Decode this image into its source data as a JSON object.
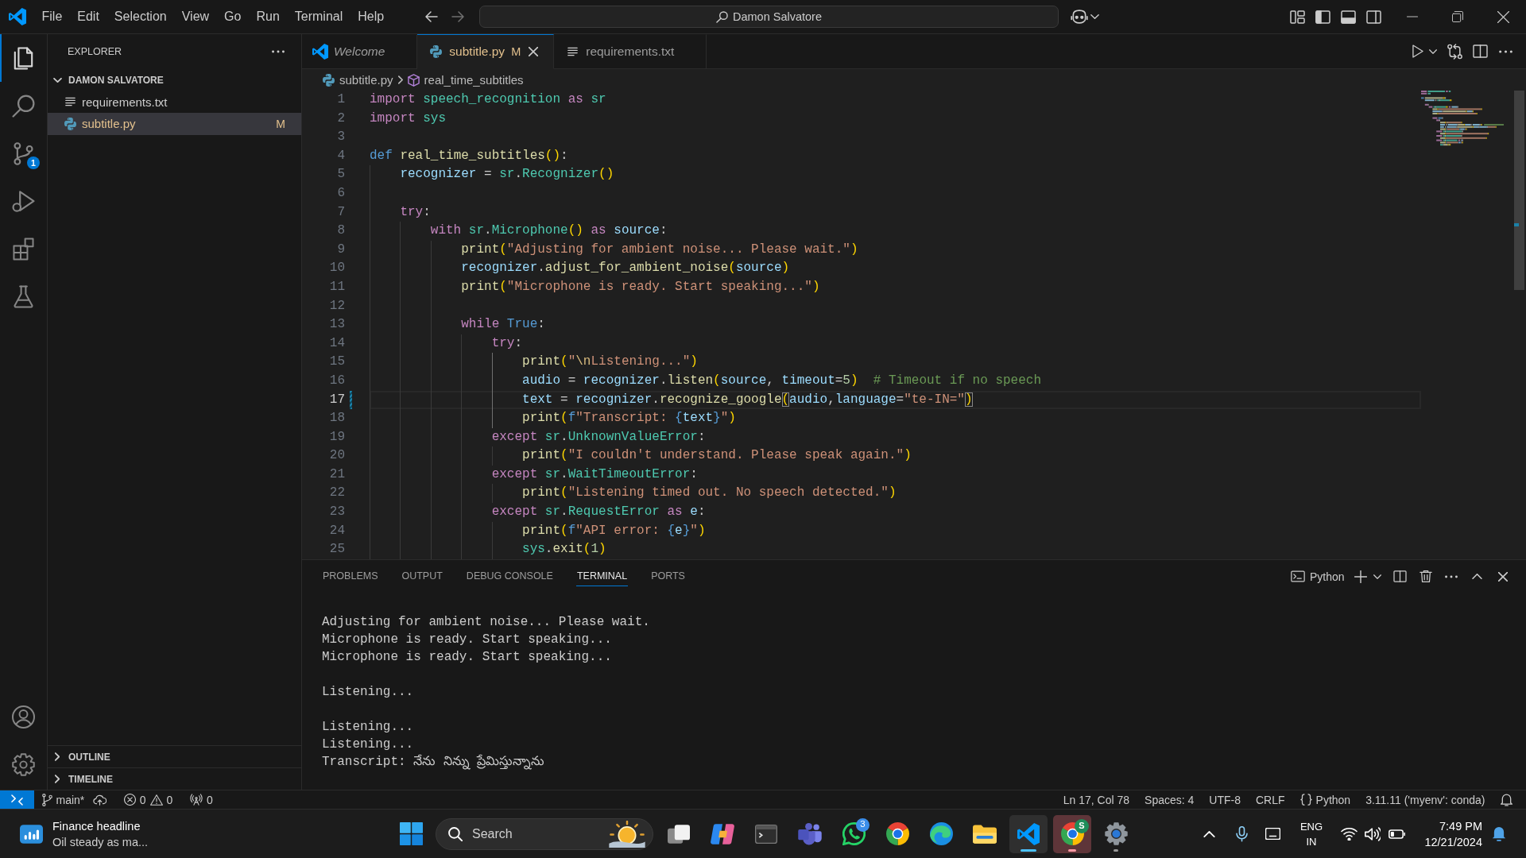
{
  "title_bar": {
    "menu": [
      "File",
      "Edit",
      "Selection",
      "View",
      "Go",
      "Run",
      "Terminal",
      "Help"
    ],
    "command_center": "Damon Salvatore",
    "layout_toggles": [
      {
        "kind": "primary_sidebar",
        "on": true
      },
      {
        "kind": "panel",
        "on": true
      },
      {
        "kind": "secondary_sidebar",
        "on": false
      }
    ]
  },
  "activity_bar": {
    "items": [
      {
        "kind": "explorer",
        "selected": true
      },
      {
        "kind": "search",
        "selected": false
      },
      {
        "kind": "source_control",
        "selected": false,
        "badge": "1"
      },
      {
        "kind": "run_debug",
        "selected": false
      },
      {
        "kind": "extensions",
        "selected": false
      },
      {
        "kind": "testing",
        "selected": false
      }
    ],
    "bottom_items": [
      {
        "kind": "accounts"
      },
      {
        "kind": "manage"
      }
    ]
  },
  "sidebar": {
    "title": "EXPLORER",
    "folder": {
      "name": "DAMON SALVATORE",
      "expanded": true,
      "files": [
        {
          "name": "requirements.txt",
          "kind": "text",
          "selected": false,
          "modified": false
        },
        {
          "name": "subtitle.py",
          "kind": "python",
          "selected": true,
          "modified": true,
          "badge": "M"
        }
      ]
    },
    "sections": [
      {
        "name": "OUTLINE",
        "expanded": false
      },
      {
        "name": "TIMELINE",
        "expanded": false
      }
    ]
  },
  "tabs": [
    {
      "label": "Welcome",
      "kind": "welcome",
      "selected": false,
      "preview": true,
      "modified": false
    },
    {
      "label": "subtitle.py",
      "kind": "python",
      "selected": true,
      "preview": false,
      "modified": true,
      "badge": "M"
    },
    {
      "label": "requirements.txt",
      "kind": "text",
      "selected": false,
      "preview": false,
      "modified": false
    }
  ],
  "breadcrumb": {
    "file": "subtitle.py",
    "symbol": "real_time_subtitles"
  },
  "editor": {
    "lines": [
      {
        "number": "1",
        "current": false,
        "changed": false,
        "tokens": [
          {
            "text": "import",
            "kind": "keyword"
          },
          {
            "text": " speech_recognition",
            "kind": "type"
          },
          {
            "text": " as",
            "kind": "keyword"
          },
          {
            "text": " sr",
            "kind": "type"
          }
        ]
      },
      {
        "number": "2",
        "current": false,
        "changed": false,
        "tokens": [
          {
            "text": "import",
            "kind": "keyword"
          },
          {
            "text": " sys",
            "kind": "type"
          }
        ]
      },
      {
        "number": "3",
        "current": false,
        "changed": false
      },
      {
        "number": "4",
        "current": false,
        "changed": false,
        "tokens": [
          {
            "text": "def",
            "kind": "storage"
          },
          {
            "text": " real_time_subtitles",
            "kind": "function"
          },
          {
            "text": "()",
            "kind": "bracket"
          },
          {
            "text": ":",
            "kind": "punctuation"
          }
        ]
      },
      {
        "number": "5",
        "current": false,
        "changed": false,
        "tokens": [
          {
            "text": "    recognizer",
            "kind": "variable"
          },
          {
            "text": " =",
            "kind": "punctuation"
          },
          {
            "text": " sr",
            "kind": "type"
          },
          {
            "text": ".",
            "kind": "punctuation"
          },
          {
            "text": "Recognizer",
            "kind": "type"
          },
          {
            "text": "()",
            "kind": "bracket"
          }
        ]
      },
      {
        "number": "6",
        "current": false,
        "changed": false
      },
      {
        "number": "7",
        "current": false,
        "changed": false,
        "tokens": [
          {
            "text": "    try",
            "kind": "keyword"
          },
          {
            "text": ":",
            "kind": "punctuation"
          }
        ]
      },
      {
        "number": "8",
        "current": false,
        "changed": false,
        "tokens": [
          {
            "text": "        with",
            "kind": "keyword"
          },
          {
            "text": " sr",
            "kind": "type"
          },
          {
            "text": ".",
            "kind": "punctuation"
          },
          {
            "text": "Microphone",
            "kind": "type"
          },
          {
            "text": "()",
            "kind": "bracket"
          },
          {
            "text": " as",
            "kind": "keyword"
          },
          {
            "text": " source",
            "kind": "variable"
          },
          {
            "text": ":",
            "kind": "punctuation"
          }
        ]
      },
      {
        "number": "9",
        "current": false,
        "changed": false,
        "tokens": [
          {
            "text": "            print",
            "kind": "function"
          },
          {
            "text": "(",
            "kind": "bracket"
          },
          {
            "text": "\"Adjusting for ambient noise... Please wait.\"",
            "kind": "string"
          },
          {
            "text": ")",
            "kind": "bracket"
          }
        ]
      },
      {
        "number": "10",
        "current": false,
        "changed": false,
        "tokens": [
          {
            "text": "            recognizer",
            "kind": "variable"
          },
          {
            "text": ".",
            "kind": "punctuation"
          },
          {
            "text": "adjust_for_ambient_noise",
            "kind": "function"
          },
          {
            "text": "(",
            "kind": "bracket"
          },
          {
            "text": "source",
            "kind": "variable"
          },
          {
            "text": ")",
            "kind": "bracket"
          }
        ]
      },
      {
        "number": "11",
        "current": false,
        "changed": false,
        "tokens": [
          {
            "text": "            print",
            "kind": "function"
          },
          {
            "text": "(",
            "kind": "bracket"
          },
          {
            "text": "\"Microphone is ready. Start speaking...\"",
            "kind": "string"
          },
          {
            "text": ")",
            "kind": "bracket"
          }
        ]
      },
      {
        "number": "12",
        "current": false,
        "changed": false
      },
      {
        "number": "13",
        "current": false,
        "changed": false,
        "tokens": [
          {
            "text": "            while",
            "kind": "keyword"
          },
          {
            "text": " True",
            "kind": "storage"
          },
          {
            "text": ":",
            "kind": "punctuation"
          }
        ]
      },
      {
        "number": "14",
        "current": false,
        "changed": false,
        "tokens": [
          {
            "text": "                try",
            "kind": "keyword"
          },
          {
            "text": ":",
            "kind": "punctuation"
          }
        ]
      },
      {
        "number": "15",
        "current": false,
        "changed": false,
        "tokens": [
          {
            "text": "                    print",
            "kind": "function"
          },
          {
            "text": "(",
            "kind": "bracket"
          },
          {
            "text": "\"",
            "kind": "string"
          },
          {
            "text": "\\n",
            "kind": "escape"
          },
          {
            "text": "Listening...\"",
            "kind": "string"
          },
          {
            "text": ")",
            "kind": "bracket"
          }
        ]
      },
      {
        "number": "16",
        "current": false,
        "changed": false,
        "tokens": [
          {
            "text": "                    audio",
            "kind": "variable"
          },
          {
            "text": " =",
            "kind": "punctuation"
          },
          {
            "text": " recognizer",
            "kind": "variable"
          },
          {
            "text": ".",
            "kind": "punctuation"
          },
          {
            "text": "listen",
            "kind": "function"
          },
          {
            "text": "(",
            "kind": "bracket"
          },
          {
            "text": "source",
            "kind": "variable"
          },
          {
            "text": ",",
            "kind": "punctuation"
          },
          {
            "text": " timeout",
            "kind": "variable"
          },
          {
            "text": "=",
            "kind": "punctuation"
          },
          {
            "text": "5",
            "kind": "number"
          },
          {
            "text": ")",
            "kind": "bracket"
          },
          {
            "text": "  # Timeout if no speech",
            "kind": "comment"
          }
        ]
      },
      {
        "number": "17",
        "current": true,
        "changed": true,
        "tokens": [
          {
            "text": "                    text",
            "kind": "variable"
          },
          {
            "text": " =",
            "kind": "punctuation"
          },
          {
            "text": " recognizer",
            "kind": "variable"
          },
          {
            "text": ".",
            "kind": "punctuation"
          },
          {
            "text": "recognize_google",
            "kind": "function"
          },
          {
            "text": "(",
            "kind": "matched_bracket"
          },
          {
            "text": "audio",
            "kind": "variable"
          },
          {
            "text": ",",
            "kind": "punctuation"
          },
          {
            "text": "language",
            "kind": "variable"
          },
          {
            "text": "=",
            "kind": "punctuation"
          },
          {
            "text": "\"te-IN=\"",
            "kind": "string"
          },
          {
            "text": ")",
            "kind": "matched_bracket"
          }
        ]
      },
      {
        "number": "18",
        "current": false,
        "changed": false,
        "tokens": [
          {
            "text": "                    print",
            "kind": "function"
          },
          {
            "text": "(",
            "kind": "bracket"
          },
          {
            "text": "f",
            "kind": "storage"
          },
          {
            "text": "\"Transcript: ",
            "kind": "string"
          },
          {
            "text": "{",
            "kind": "storage"
          },
          {
            "text": "text",
            "kind": "variable"
          },
          {
            "text": "}",
            "kind": "storage"
          },
          {
            "text": "\"",
            "kind": "string"
          },
          {
            "text": ")",
            "kind": "bracket"
          }
        ]
      },
      {
        "number": "19",
        "current": false,
        "changed": false,
        "tokens": [
          {
            "text": "                except",
            "kind": "keyword"
          },
          {
            "text": " sr",
            "kind": "type"
          },
          {
            "text": ".",
            "kind": "punctuation"
          },
          {
            "text": "UnknownValueError",
            "kind": "type"
          },
          {
            "text": ":",
            "kind": "punctuation"
          }
        ]
      },
      {
        "number": "20",
        "current": false,
        "changed": false,
        "tokens": [
          {
            "text": "                    print",
            "kind": "function"
          },
          {
            "text": "(",
            "kind": "bracket"
          },
          {
            "text": "\"I couldn't understand. Please speak again.\"",
            "kind": "string"
          },
          {
            "text": ")",
            "kind": "bracket"
          }
        ]
      },
      {
        "number": "21",
        "current": false,
        "changed": false,
        "tokens": [
          {
            "text": "                except",
            "kind": "keyword"
          },
          {
            "text": " sr",
            "kind": "type"
          },
          {
            "text": ".",
            "kind": "punctuation"
          },
          {
            "text": "WaitTimeoutError",
            "kind": "type"
          },
          {
            "text": ":",
            "kind": "punctuation"
          }
        ]
      },
      {
        "number": "22",
        "current": false,
        "changed": false,
        "tokens": [
          {
            "text": "                    print",
            "kind": "function"
          },
          {
            "text": "(",
            "kind": "bracket"
          },
          {
            "text": "\"Listening timed out. No speech detected.\"",
            "kind": "string"
          },
          {
            "text": ")",
            "kind": "bracket"
          }
        ]
      },
      {
        "number": "23",
        "current": false,
        "changed": false,
        "tokens": [
          {
            "text": "                except",
            "kind": "keyword"
          },
          {
            "text": " sr",
            "kind": "type"
          },
          {
            "text": ".",
            "kind": "punctuation"
          },
          {
            "text": "RequestError",
            "kind": "type"
          },
          {
            "text": " as",
            "kind": "keyword"
          },
          {
            "text": " e",
            "kind": "variable"
          },
          {
            "text": ":",
            "kind": "punctuation"
          }
        ]
      },
      {
        "number": "24",
        "current": false,
        "changed": false,
        "tokens": [
          {
            "text": "                    print",
            "kind": "function"
          },
          {
            "text": "(",
            "kind": "bracket"
          },
          {
            "text": "f",
            "kind": "storage"
          },
          {
            "text": "\"API error: ",
            "kind": "string"
          },
          {
            "text": "{",
            "kind": "storage"
          },
          {
            "text": "e",
            "kind": "variable"
          },
          {
            "text": "}",
            "kind": "storage"
          },
          {
            "text": "\"",
            "kind": "string"
          },
          {
            "text": ")",
            "kind": "bracket"
          }
        ]
      },
      {
        "number": "25",
        "current": false,
        "changed": false,
        "tokens": [
          {
            "text": "                    sys",
            "kind": "type"
          },
          {
            "text": ".",
            "kind": "punctuation"
          },
          {
            "text": "exit",
            "kind": "function"
          },
          {
            "text": "(",
            "kind": "bracket"
          },
          {
            "text": "1",
            "kind": "number"
          },
          {
            "text": ")",
            "kind": "bracket"
          }
        ]
      }
    ]
  },
  "panel": {
    "tabs": [
      {
        "label": "PROBLEMS",
        "selected": false
      },
      {
        "label": "OUTPUT",
        "selected": false
      },
      {
        "label": "DEBUG CONSOLE",
        "selected": false
      },
      {
        "label": "TERMINAL",
        "selected": true
      },
      {
        "label": "PORTS",
        "selected": false
      }
    ],
    "terminal_profile": "Python",
    "terminal_blocks": [
      [
        "Adjusting for ambient noise... Please wait.",
        "Microphone is ready. Start speaking...",
        "Microphone is ready. Start speaking..."
      ],
      [
        "Listening..."
      ],
      [
        "Listening...",
        "Listening...",
        "Transcript: నేను నిన్ను ప్రేమిస్తున్నాను"
      ]
    ]
  },
  "status_bar": {
    "branch": "main*",
    "errors": "0",
    "warnings": "0",
    "ports": "0",
    "items": [
      "Ln 17, Col 78",
      "Spaces: 4",
      "UTF-8",
      "CRLF"
    ],
    "language": "Python",
    "interpreter": "3.11.11 ('myenv': conda)"
  },
  "taskbar": {
    "widget": {
      "title": "Finance headline",
      "subtitle": "Oil steady as ma..."
    },
    "search": {
      "placeholder": "Search"
    },
    "apps": [
      {
        "kind": "task_view",
        "running": false,
        "selected": false,
        "attention": false
      },
      {
        "kind": "copilot",
        "running": false,
        "selected": false,
        "attention": false
      },
      {
        "kind": "terminal",
        "running": false,
        "selected": false,
        "attention": false
      },
      {
        "kind": "teams",
        "running": false,
        "selected": false,
        "attention": false
      },
      {
        "kind": "whatsapp",
        "running": false,
        "selected": false,
        "attention": false,
        "badge": "3"
      },
      {
        "kind": "chrome",
        "running": false,
        "selected": false,
        "attention": false
      },
      {
        "kind": "edge",
        "running": false,
        "selected": false,
        "attention": false
      },
      {
        "kind": "file_explorer",
        "running": false,
        "selected": false,
        "attention": false
      },
      {
        "kind": "vscode",
        "running": true,
        "selected": true,
        "attention": false
      },
      {
        "kind": "chrome",
        "running": true,
        "selected": false,
        "attention": true,
        "profile": "S"
      },
      {
        "kind": "settings",
        "running": true,
        "selected": false,
        "attention": false
      }
    ],
    "language": [
      "ENG",
      "IN"
    ],
    "time": "7:49 PM",
    "date": "12/21/2024"
  }
}
